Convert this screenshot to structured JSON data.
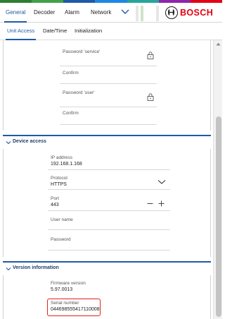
{
  "brand": {
    "logo_text": "BOSCH",
    "strip_colors": [
      "#2e7d32",
      "#43a047",
      "#1f5aa6",
      "#1e88e5",
      "#26a69a",
      "#8e24aa",
      "#e20015"
    ]
  },
  "nav": {
    "tabs": [
      {
        "label": "General",
        "active": true
      },
      {
        "label": "Decoder",
        "active": false
      },
      {
        "label": "Alarm",
        "active": false
      },
      {
        "label": "Network",
        "active": false
      }
    ],
    "more_icon": "chevron-down-icon"
  },
  "subtabs": [
    {
      "label": "Unit Access",
      "active": true
    },
    {
      "label": "Date/Time",
      "active": false
    },
    {
      "label": "Initialization",
      "active": false
    }
  ],
  "passwords": {
    "service_label": "Password 'service'",
    "service_confirm_label": "Confirm",
    "user_label": "Password 'user'",
    "user_confirm_label": "Confirm",
    "lock_icon": "lock-icon"
  },
  "device_access": {
    "title": "Device access",
    "ip_label": "IP address",
    "ip_value": "192.168.1.168",
    "protocol_label": "Protocol",
    "protocol_value": "HTTPS",
    "port_label": "Port",
    "port_value": "443",
    "username_label": "User name",
    "password_label": "Password"
  },
  "version_info": {
    "title": "Version information",
    "firmware_label": "Firmware version",
    "firmware_value": "5.97.0013",
    "serial_label": "Serial number",
    "serial_value": "044698555417110008"
  },
  "colors": {
    "accent": "#1f5aa6",
    "highlight": "#e2231a",
    "brand_red": "#e20015"
  }
}
